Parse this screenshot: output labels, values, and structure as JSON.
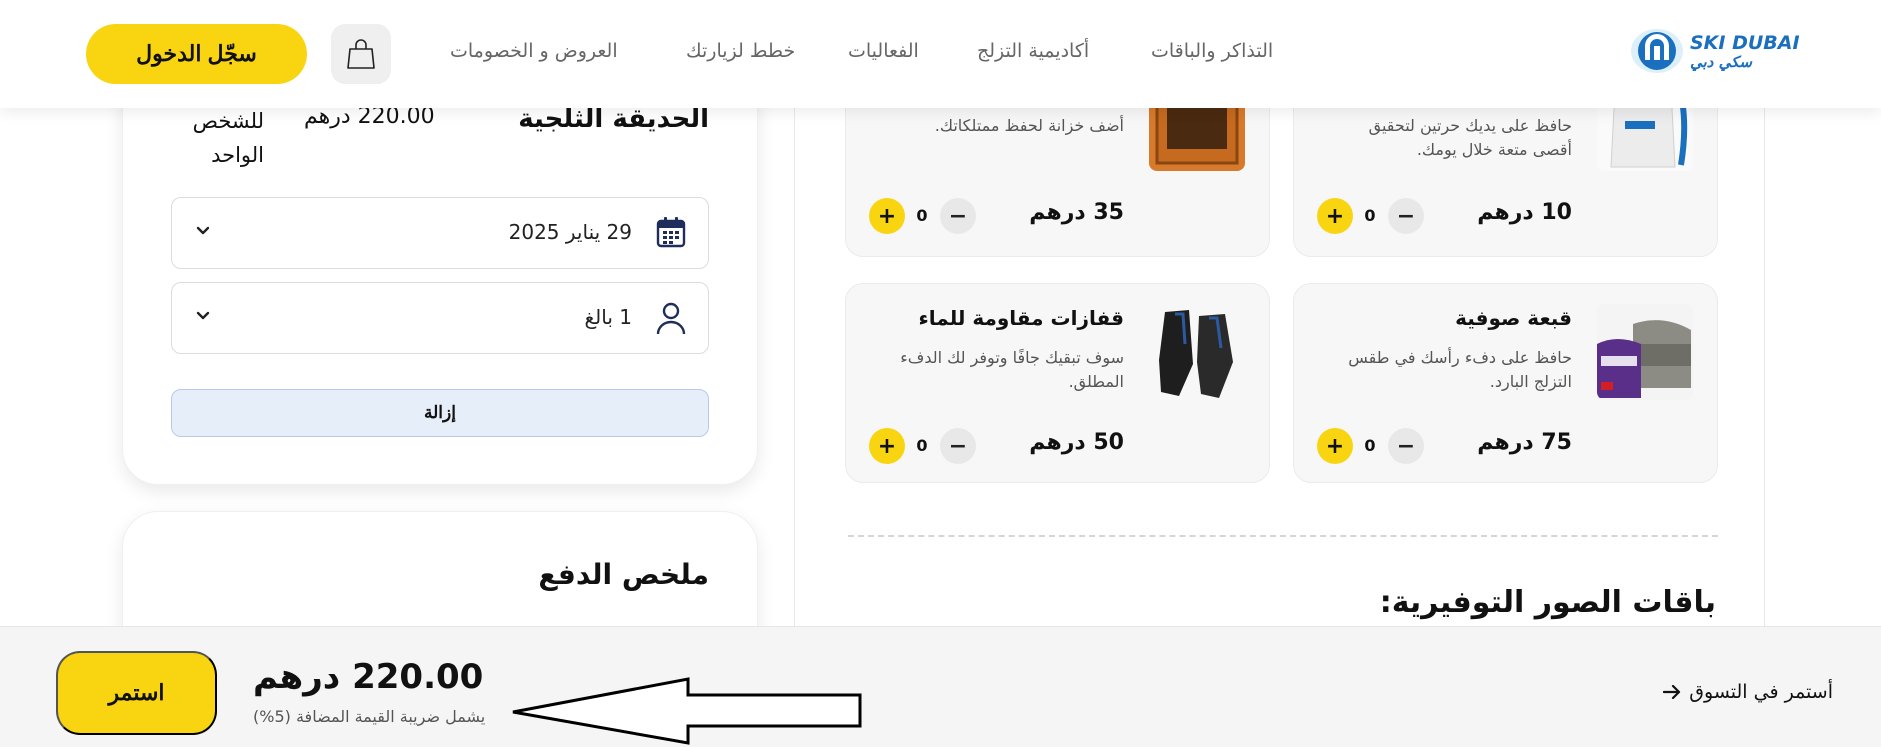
{
  "header": {
    "logo": {
      "text_en": "SKI DUBAI",
      "text_ar": "سكي دبي"
    },
    "nav": [
      "التذاكر والباقات",
      "أكاديمية التزلج",
      "الفعاليات",
      "خطط لزيارتك",
      "العروض و الخصومات"
    ],
    "cart_icon": "shopping-bag-icon",
    "login_label": "سجّل الدخول"
  },
  "booking": {
    "title": "الحديقة الثلجية",
    "price": "220.00 درهم",
    "per_person": "للشخص الواحد",
    "date": {
      "value": "29 يناير 2025",
      "icon": "calendar-icon"
    },
    "guests": {
      "value": "1 بالغ",
      "icon": "user-icon"
    },
    "remove_label": "إزالة"
  },
  "payment_summary": {
    "title": "ملخص الدفع"
  },
  "addons": [
    {
      "title": "",
      "desc": "حافظ على يديك حرتين لتحقيق أقصى متعة خلال يومك.",
      "price": "10 درهم",
      "qty": "0"
    },
    {
      "title": "",
      "desc": "أضف خزانة لحفظ ممتلكاتك.",
      "price": "35 درهم",
      "qty": "0"
    },
    {
      "title": "قبعة صوفية",
      "desc": "حافظ على دفء رأسك في طقس التزلج البارد.",
      "price": "75 درهم",
      "qty": "0"
    },
    {
      "title": "قفازات مقاومة للماء",
      "desc": "سوف تبقيك جافًا وتوفر لك الدفء المطلق.",
      "price": "50 درهم",
      "qty": "0"
    }
  ],
  "photo_packages": {
    "title": "باقات الصور التوفيرية:"
  },
  "footer": {
    "continue_label": "استمر",
    "total": "220.00 درهم",
    "vat_note": "يشمل ضريبة القيمة المضافة (5%)",
    "keep_shopping": "أستمر في التسوق"
  },
  "colors": {
    "accent": "#f8d510",
    "brand": "#1b6fbf",
    "navy": "#1f2d5c"
  }
}
